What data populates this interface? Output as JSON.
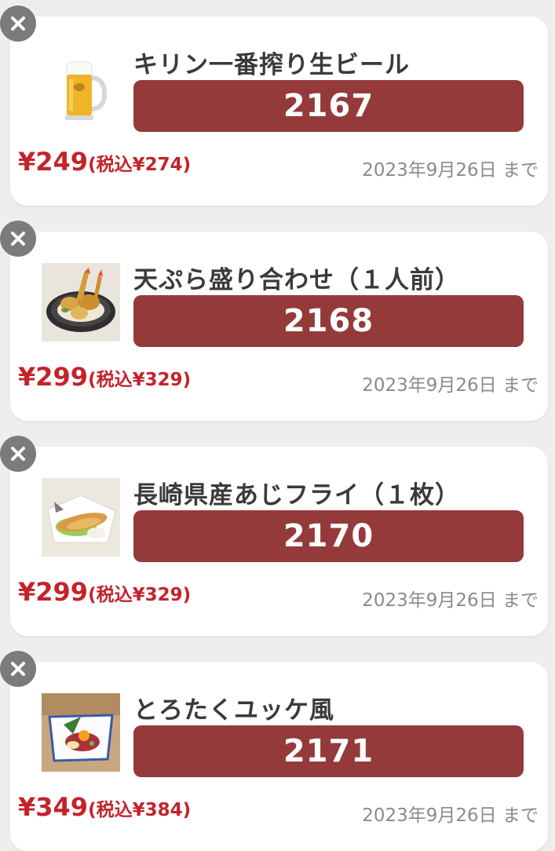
{
  "coupons": [
    {
      "name": "キリン一番搾り生ビール",
      "code": "2167",
      "price": "¥249",
      "tax_price": "(税込¥274)",
      "expiry": "2023年9月26日 まで",
      "thumb_icon": "beer-mug-icon"
    },
    {
      "name": "天ぷら盛り合わせ（１人前）",
      "code": "2168",
      "price": "¥299",
      "tax_price": "(税込¥329)",
      "expiry": "2023年9月26日 まで",
      "thumb_icon": "tempura-plate-icon"
    },
    {
      "name": "長崎県産あじフライ（１枚）",
      "code": "2170",
      "price": "¥299",
      "tax_price": "(税込¥329)",
      "expiry": "2023年9月26日 まで",
      "thumb_icon": "fried-fish-icon"
    },
    {
      "name": "とろたくユッケ風",
      "code": "2171",
      "price": "¥349",
      "tax_price": "(税込¥384)",
      "expiry": "2023年9月26日 まで",
      "thumb_icon": "yukhoe-bowl-icon"
    }
  ],
  "colors": {
    "code_box": "#943a3a",
    "price_red": "#c4232b",
    "page_background": "#efeeed",
    "close_button": "#7b7b7b"
  }
}
